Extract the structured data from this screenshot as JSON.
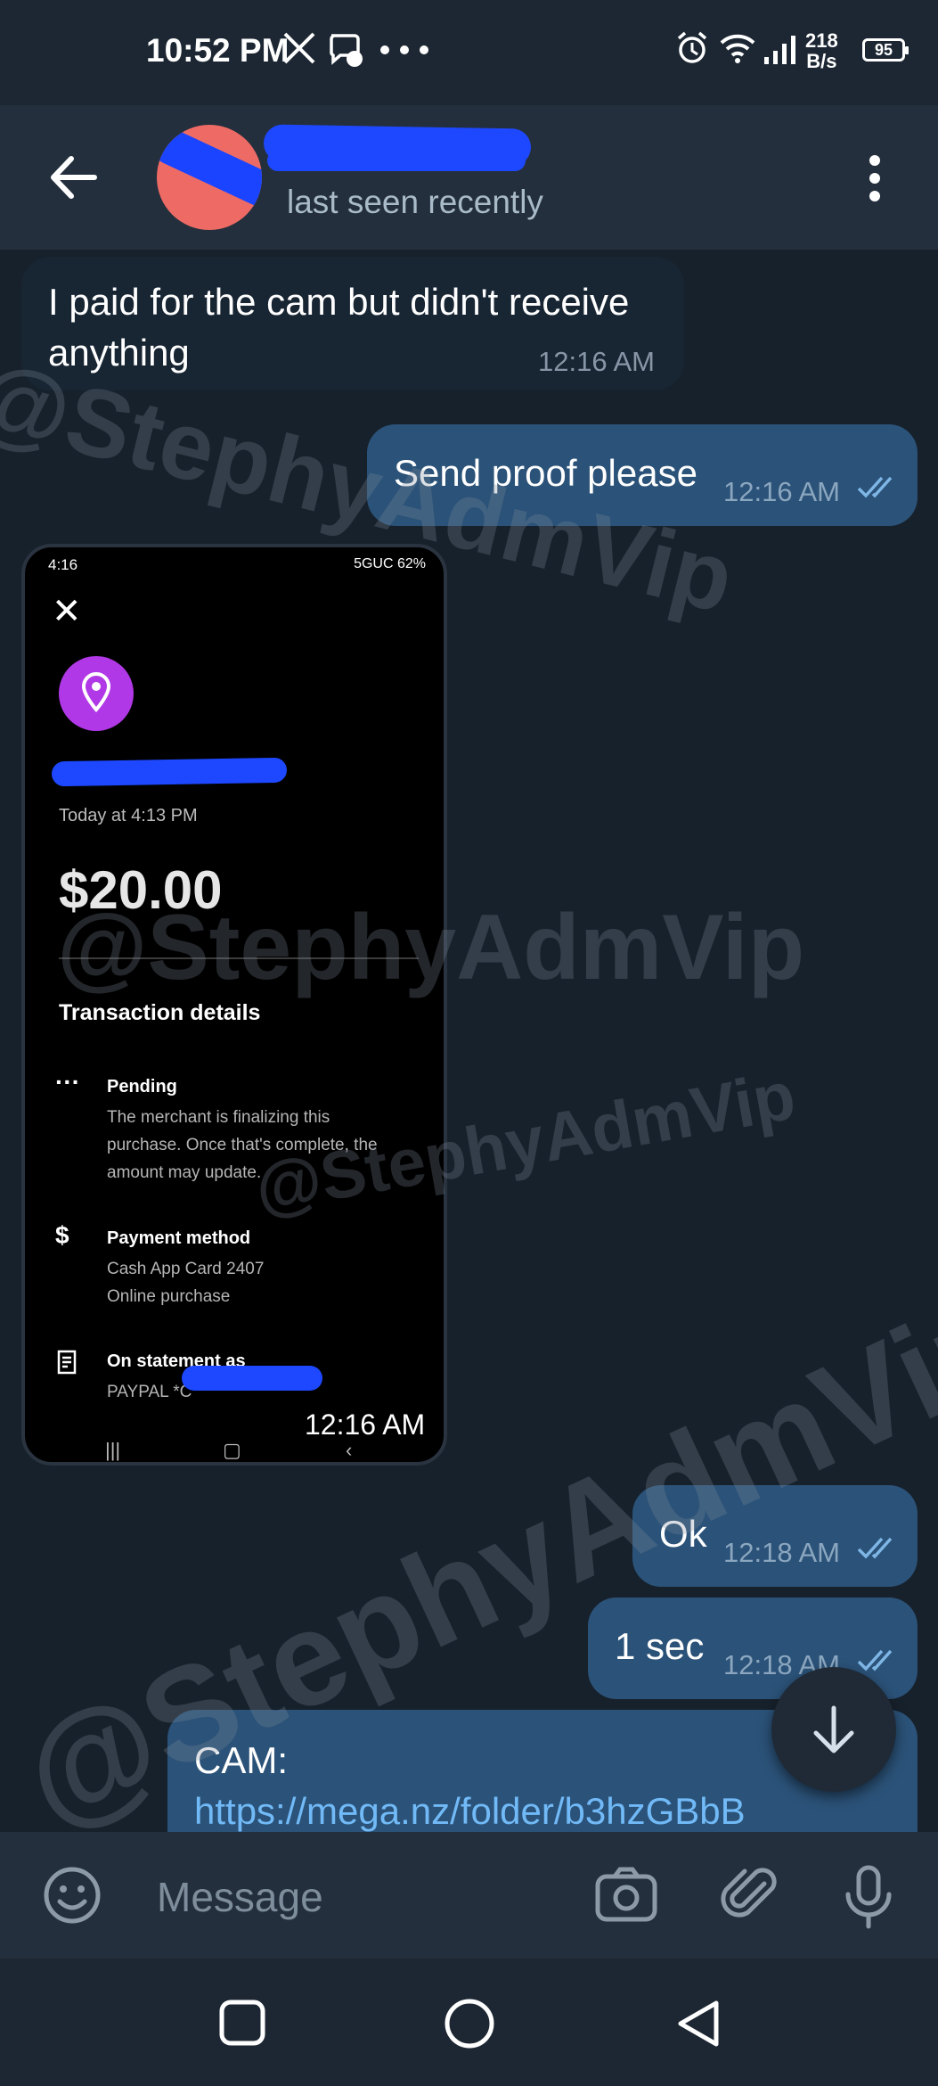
{
  "status_bar": {
    "time": "10:52 PM",
    "net_speed_value": "218",
    "net_speed_unit": "B/s",
    "battery": "95",
    "icons": [
      "x-icon",
      "messenger-icon",
      "more-dots-icon",
      "alarm-icon",
      "wifi-icon",
      "signal-icon",
      "battery-icon"
    ]
  },
  "header": {
    "status": "last seen recently",
    "icons": [
      "back-arrow-icon",
      "avatar",
      "more-vertical-icon"
    ]
  },
  "messages": [
    {
      "direction": "incoming",
      "lines": [
        "I paid for the cam but didn't receive",
        "anything"
      ],
      "time": "12:16 AM"
    },
    {
      "direction": "outgoing",
      "text": "Send proof please",
      "time": "12:16 AM",
      "read": true
    },
    {
      "direction": "incoming",
      "type": "photo",
      "time": "12:16 AM",
      "photo": {
        "status_time": "4:16",
        "status_right": "5GUC 62%",
        "date": "Today at 4:13 PM",
        "amount": "$20.00",
        "section": "Transaction details",
        "rows": [
          {
            "icon": "ellipsis-icon",
            "title": "Pending",
            "lines": [
              "The merchant is finalizing this",
              "purchase. Once that's complete, the",
              "amount may update."
            ]
          },
          {
            "icon": "dollar-icon",
            "title": "Payment method",
            "lines": [
              "Cash App Card 2407",
              "Online purchase"
            ]
          },
          {
            "icon": "receipt-icon",
            "title": "On statement as",
            "lines": [
              "PAYPAL *C"
            ]
          }
        ],
        "nav": [
          "|||",
          "▢",
          "‹"
        ]
      }
    },
    {
      "direction": "outgoing",
      "text": "Ok",
      "time": "12:18 AM",
      "read": true
    },
    {
      "direction": "outgoing",
      "text": "1 sec",
      "time": "12:18 AM",
      "read": true
    },
    {
      "direction": "outgoing",
      "label": "CAM:",
      "link": "https://mega.nz/folder/b3hzGBbB"
    }
  ],
  "watermark": "@StephyAdmVip",
  "input": {
    "placeholder": "Message",
    "icons": [
      "emoji-icon",
      "camera-icon",
      "attach-icon",
      "mic-icon"
    ]
  },
  "colors": {
    "background": "#17212b",
    "header": "#242f3d",
    "incoming_bubble": "#182533",
    "outgoing_bubble": "#2b5278",
    "link": "#71baf7",
    "avatar": "#ee6b65"
  }
}
